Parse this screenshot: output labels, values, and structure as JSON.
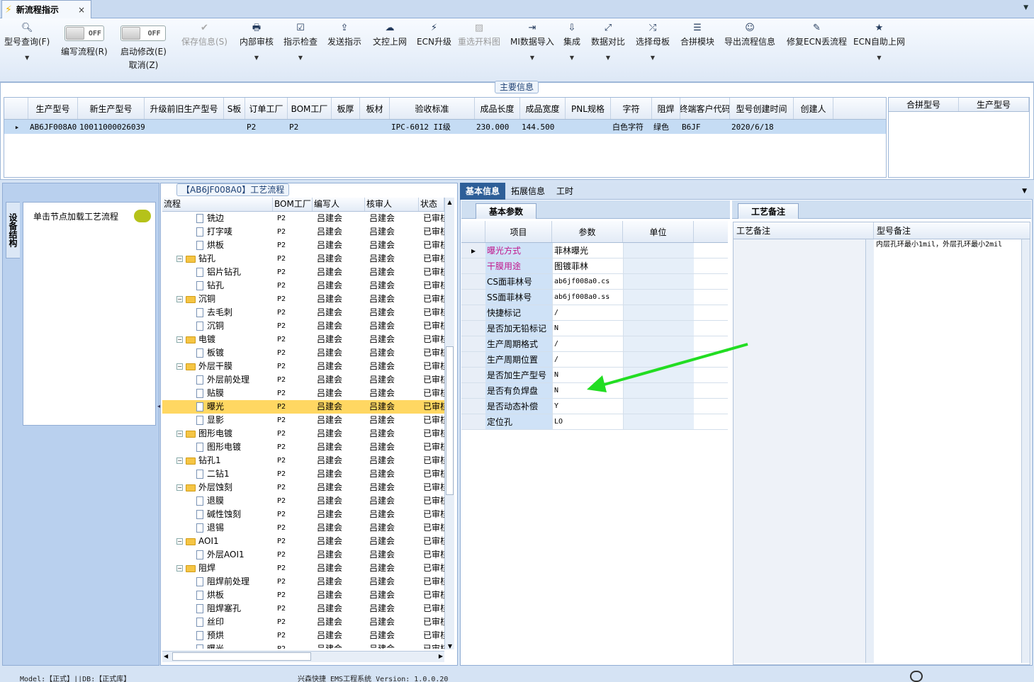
{
  "tab": {
    "title": "新流程指示",
    "close": "×"
  },
  "toolbar": {
    "query": {
      "label": "型号查询(F)",
      "icon": "search-icon"
    },
    "edit_flow": {
      "label": "编写流程(R)",
      "toggle": "OFF"
    },
    "start_modify": {
      "label": "启动修改(E)",
      "label2": "取消(Z)",
      "toggle": "OFF"
    },
    "items": [
      {
        "label": "保存信息(S)",
        "icon": "✔",
        "disabled": true,
        "dd": false
      },
      {
        "label": "内部审核",
        "icon": "🖶",
        "dd": true
      },
      {
        "label": "指示检查",
        "icon": "☑",
        "dd": true
      },
      {
        "label": "发送指示",
        "icon": "⇪",
        "dd": false
      },
      {
        "label": "文控上网",
        "icon": "☁",
        "dd": false
      },
      {
        "label": "ECN升级",
        "icon": "⚡",
        "dd": false
      },
      {
        "label": "重选开料图",
        "icon": "▨",
        "disabled": true,
        "dd": false
      },
      {
        "label": "MI数据导入",
        "icon": "⇥",
        "dd": true
      },
      {
        "label": "集成",
        "icon": "⇩",
        "dd": true
      },
      {
        "label": "数据对比",
        "icon": "⤢",
        "dd": true
      },
      {
        "label": "选择母板",
        "icon": "⤮",
        "dd": true
      },
      {
        "label": "合拼模块",
        "icon": "☰",
        "dd": false
      },
      {
        "label": "导出流程信息",
        "icon": "☺",
        "dd": false
      },
      {
        "label": "修复ECN丢流程",
        "icon": "✎",
        "dd": false
      },
      {
        "label": "ECN自助上网",
        "icon": "★",
        "dd": true
      }
    ]
  },
  "main_info": {
    "caption": "主要信息",
    "columns": [
      "生产型号",
      "新生产型号",
      "升级前旧生产型号",
      "S板",
      "订单工厂",
      "BOM工厂",
      "板厚",
      "板材",
      "验收标准",
      "成品长度",
      "成品宽度",
      "PNL规格",
      "字符",
      "阻焊",
      "终端客户代码",
      "型号创建时间",
      "创建人"
    ],
    "row": [
      "AB6JF008A0",
      "10011000026039",
      "",
      "",
      "P2",
      "P2",
      "",
      "",
      "IPC-6012 II级",
      "230.000",
      "144.500",
      "",
      "白色字符",
      "绿色",
      "B6JF",
      "2020/6/18",
      ""
    ],
    "side_columns": [
      "合拼型号",
      "生产型号"
    ]
  },
  "left_panel": {
    "vertical_tab": "设备结构",
    "hint": "单击节点加载工艺流程"
  },
  "flow": {
    "caption": "【AB6JF008A0】工艺流程",
    "columns": [
      "流程",
      "BOM工厂",
      "编写人",
      "核审人",
      "状态"
    ],
    "rows": [
      {
        "name": "铣边",
        "lvl": 2,
        "folder": false
      },
      {
        "name": "打字唛",
        "lvl": 2,
        "folder": false
      },
      {
        "name": "烘板",
        "lvl": 2,
        "folder": false
      },
      {
        "name": "钻孔",
        "lvl": 1,
        "folder": true
      },
      {
        "name": "铝片钻孔",
        "lvl": 2,
        "folder": false
      },
      {
        "name": "钻孔",
        "lvl": 2,
        "folder": false
      },
      {
        "name": "沉铜",
        "lvl": 1,
        "folder": true
      },
      {
        "name": "去毛刺",
        "lvl": 2,
        "folder": false
      },
      {
        "name": "沉铜",
        "lvl": 2,
        "folder": false
      },
      {
        "name": "电镀",
        "lvl": 1,
        "folder": true
      },
      {
        "name": "板镀",
        "lvl": 2,
        "folder": false
      },
      {
        "name": "外层干膜",
        "lvl": 1,
        "folder": true
      },
      {
        "name": "外层前处理",
        "lvl": 2,
        "folder": false
      },
      {
        "name": "贴膜",
        "lvl": 2,
        "folder": false
      },
      {
        "name": "曝光",
        "lvl": 2,
        "folder": false,
        "selected": true
      },
      {
        "name": "显影",
        "lvl": 2,
        "folder": false
      },
      {
        "name": "图形电镀",
        "lvl": 1,
        "folder": true
      },
      {
        "name": "图形电镀",
        "lvl": 2,
        "folder": false
      },
      {
        "name": "钻孔1",
        "lvl": 1,
        "folder": true
      },
      {
        "name": "二钻1",
        "lvl": 2,
        "folder": false
      },
      {
        "name": "外层蚀刻",
        "lvl": 1,
        "folder": true
      },
      {
        "name": "退膜",
        "lvl": 2,
        "folder": false
      },
      {
        "name": "碱性蚀刻",
        "lvl": 2,
        "folder": false
      },
      {
        "name": "退锡",
        "lvl": 2,
        "folder": false
      },
      {
        "name": "AOI1",
        "lvl": 1,
        "folder": true
      },
      {
        "name": "外层AOI1",
        "lvl": 2,
        "folder": false
      },
      {
        "name": "阻焊",
        "lvl": 1,
        "folder": true
      },
      {
        "name": "阻焊前处理",
        "lvl": 2,
        "folder": false
      },
      {
        "name": "烘板",
        "lvl": 2,
        "folder": false
      },
      {
        "name": "阻焊塞孔",
        "lvl": 2,
        "folder": false
      },
      {
        "name": "丝印",
        "lvl": 2,
        "folder": false
      },
      {
        "name": "预烘",
        "lvl": 2,
        "folder": false
      },
      {
        "name": "曝光",
        "lvl": 2,
        "folder": false
      }
    ],
    "bom": "P2",
    "writer": "吕建会",
    "reviewer": "吕建会",
    "status": "已审核"
  },
  "right": {
    "tabs": [
      "基本信息",
      "拓展信息",
      "工时"
    ],
    "basic_tab": "基本参数",
    "process_tab": "工艺备注",
    "param_columns": [
      "项目",
      "参数",
      "单位"
    ],
    "params": [
      {
        "item": "曝光方式",
        "value": "菲林曝光",
        "hl": true
      },
      {
        "item": "干膜用途",
        "value": "图镀菲林",
        "hl": true
      },
      {
        "item": "CS面菲林号",
        "value": "ab6jf008a0.cs"
      },
      {
        "item": "SS面菲林号",
        "value": "ab6jf008a0.ss"
      },
      {
        "item": "快捷标记",
        "value": "/"
      },
      {
        "item": "是否加无铅标记",
        "value": "N"
      },
      {
        "item": "生产周期格式",
        "value": "/"
      },
      {
        "item": "生产周期位置",
        "value": "/"
      },
      {
        "item": "是否加生产型号",
        "value": "N"
      },
      {
        "item": "是否有负焊盘",
        "value": "N"
      },
      {
        "item": "是否动态补偿",
        "value": "Y"
      },
      {
        "item": "定位孔",
        "value": "LO"
      }
    ],
    "note_columns": [
      "工艺备注",
      "型号备注"
    ],
    "model_note": "内层孔环最小1mil，外层孔环最小2mil"
  },
  "status_bar": {
    "left": "Model:【正式】||DB:【正式库】",
    "center": "兴森快捷 EMS工程系统 Version: 1.0.0.20"
  },
  "colors": {
    "accent": "#2e5f98",
    "selected_row": "#ffd762",
    "highlight_text": "#c0178c",
    "arrow": "#22dd22"
  }
}
